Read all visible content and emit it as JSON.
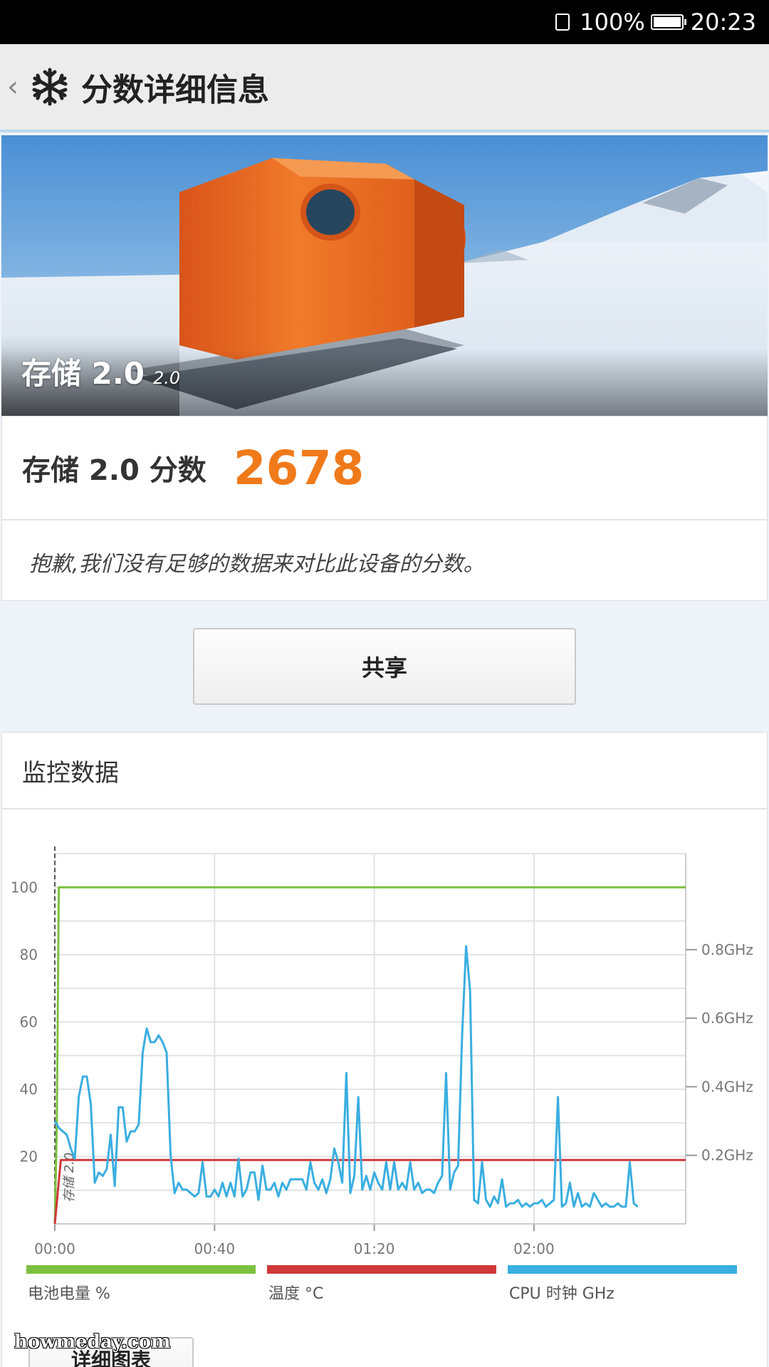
{
  "status_bar": {
    "battery": "100%",
    "time": "20:23"
  },
  "app_bar": {
    "back_icon": "chevron-left-icon",
    "logo_icon": "snowflake-icon",
    "title": "分数详细信息"
  },
  "hero": {
    "name": "存储 2.0",
    "version": "2.0"
  },
  "score": {
    "label": "存储 2.0 分数",
    "value": "2678",
    "value_color": "#f07a1a",
    "note": "抱歉,我们没有足够的数据来对比此设备的分数。"
  },
  "share_button": "共享",
  "monitor": {
    "title": "监控数据",
    "legend": [
      {
        "label": "电池电量 %",
        "color": "#7cc13f"
      },
      {
        "label": "温度 °C",
        "color": "#d0383a"
      },
      {
        "label": "CPU 时钟 GHz",
        "color": "#3aaee0"
      }
    ],
    "marker_label": "存储 2.0"
  },
  "chart_data": {
    "type": "line",
    "x_ticks": [
      "00:00",
      "00:40",
      "01:20",
      "02:00"
    ],
    "x_range_minutes": [
      0,
      158
    ],
    "y_left_ticks": [
      "100",
      "80",
      "60",
      "40",
      "20"
    ],
    "y_left_range": [
      0,
      110
    ],
    "y_right_ticks": [
      "0.8GHz",
      "0.6GHz",
      "0.4GHz",
      "0.2GHz"
    ],
    "y_right_range_ghz": [
      0,
      1.08
    ],
    "grid": true,
    "legend_position": "bottom",
    "series": [
      {
        "name": "电池电量 %",
        "axis": "left",
        "points": [
          [
            0,
            0
          ],
          [
            0.5,
            30
          ],
          [
            1,
            100
          ],
          [
            158,
            100
          ]
        ]
      },
      {
        "name": "温度 °C",
        "axis": "left",
        "points": [
          [
            0,
            0
          ],
          [
            1.5,
            19
          ],
          [
            158,
            19
          ]
        ]
      },
      {
        "name": "CPU 时钟 GHz",
        "axis": "right",
        "points": [
          [
            0,
            0.3
          ],
          [
            1,
            0.28
          ],
          [
            2,
            0.27
          ],
          [
            3,
            0.26
          ],
          [
            4,
            0.22
          ],
          [
            5,
            0.19
          ],
          [
            6,
            0.37
          ],
          [
            7,
            0.43
          ],
          [
            8,
            0.43
          ],
          [
            9,
            0.35
          ],
          [
            10,
            0.12
          ],
          [
            11,
            0.15
          ],
          [
            12,
            0.14
          ],
          [
            13,
            0.16
          ],
          [
            14,
            0.26
          ],
          [
            15,
            0.11
          ],
          [
            16,
            0.34
          ],
          [
            17,
            0.34
          ],
          [
            18,
            0.24
          ],
          [
            19,
            0.27
          ],
          [
            20,
            0.27
          ],
          [
            21,
            0.29
          ],
          [
            22,
            0.5
          ],
          [
            23,
            0.57
          ],
          [
            24,
            0.53
          ],
          [
            25,
            0.53
          ],
          [
            26,
            0.55
          ],
          [
            27,
            0.53
          ],
          [
            28,
            0.5
          ],
          [
            29,
            0.2
          ],
          [
            30,
            0.09
          ],
          [
            31,
            0.12
          ],
          [
            32,
            0.1
          ],
          [
            33,
            0.1
          ],
          [
            34,
            0.09
          ],
          [
            35,
            0.08
          ],
          [
            36,
            0.09
          ],
          [
            37,
            0.18
          ],
          [
            38,
            0.08
          ],
          [
            39,
            0.08
          ],
          [
            40,
            0.1
          ],
          [
            41,
            0.08
          ],
          [
            42,
            0.12
          ],
          [
            43,
            0.08
          ],
          [
            44,
            0.12
          ],
          [
            45,
            0.08
          ],
          [
            46,
            0.19
          ],
          [
            47,
            0.08
          ],
          [
            48,
            0.1
          ],
          [
            49,
            0.15
          ],
          [
            50,
            0.15
          ],
          [
            51,
            0.07
          ],
          [
            52,
            0.17
          ],
          [
            53,
            0.1
          ],
          [
            54,
            0.1
          ],
          [
            55,
            0.12
          ],
          [
            56,
            0.08
          ],
          [
            57,
            0.12
          ],
          [
            58,
            0.1
          ],
          [
            59,
            0.13
          ],
          [
            60,
            0.13
          ],
          [
            61,
            0.13
          ],
          [
            62,
            0.13
          ],
          [
            63,
            0.1
          ],
          [
            64,
            0.18
          ],
          [
            65,
            0.12
          ],
          [
            66,
            0.1
          ],
          [
            67,
            0.13
          ],
          [
            68,
            0.09
          ],
          [
            69,
            0.13
          ],
          [
            70,
            0.22
          ],
          [
            71,
            0.18
          ],
          [
            72,
            0.12
          ],
          [
            73,
            0.44
          ],
          [
            74,
            0.09
          ],
          [
            75,
            0.14
          ],
          [
            76,
            0.37
          ],
          [
            77,
            0.1
          ],
          [
            78,
            0.14
          ],
          [
            79,
            0.1
          ],
          [
            80,
            0.15
          ],
          [
            81,
            0.12
          ],
          [
            82,
            0.1
          ],
          [
            83,
            0.18
          ],
          [
            84,
            0.1
          ],
          [
            85,
            0.18
          ],
          [
            86,
            0.1
          ],
          [
            87,
            0.12
          ],
          [
            88,
            0.1
          ],
          [
            89,
            0.18
          ],
          [
            90,
            0.1
          ],
          [
            91,
            0.12
          ],
          [
            92,
            0.09
          ],
          [
            93,
            0.1
          ],
          [
            94,
            0.1
          ],
          [
            95,
            0.09
          ],
          [
            96,
            0.12
          ],
          [
            97,
            0.14
          ],
          [
            98,
            0.44
          ],
          [
            99,
            0.1
          ],
          [
            100,
            0.15
          ],
          [
            101,
            0.17
          ],
          [
            102,
            0.55
          ],
          [
            103,
            0.81
          ],
          [
            104,
            0.68
          ],
          [
            105,
            0.07
          ],
          [
            106,
            0.06
          ],
          [
            107,
            0.18
          ],
          [
            108,
            0.07
          ],
          [
            109,
            0.05
          ],
          [
            110,
            0.08
          ],
          [
            111,
            0.06
          ],
          [
            112,
            0.13
          ],
          [
            113,
            0.05
          ],
          [
            114,
            0.06
          ],
          [
            115,
            0.06
          ],
          [
            116,
            0.07
          ],
          [
            117,
            0.05
          ],
          [
            118,
            0.06
          ],
          [
            119,
            0.05
          ],
          [
            120,
            0.06
          ],
          [
            121,
            0.06
          ],
          [
            122,
            0.07
          ],
          [
            123,
            0.05
          ],
          [
            124,
            0.06
          ],
          [
            125,
            0.07
          ],
          [
            126,
            0.37
          ],
          [
            127,
            0.05
          ],
          [
            128,
            0.06
          ],
          [
            129,
            0.12
          ],
          [
            130,
            0.05
          ],
          [
            131,
            0.09
          ],
          [
            132,
            0.05
          ],
          [
            133,
            0.06
          ],
          [
            134,
            0.05
          ],
          [
            135,
            0.09
          ],
          [
            136,
            0.07
          ],
          [
            137,
            0.05
          ],
          [
            138,
            0.06
          ],
          [
            139,
            0.05
          ],
          [
            140,
            0.05
          ],
          [
            141,
            0.06
          ],
          [
            142,
            0.05
          ],
          [
            143,
            0.05
          ],
          [
            144,
            0.18
          ],
          [
            145,
            0.06
          ],
          [
            146,
            0.05
          ]
        ]
      }
    ]
  },
  "detail_button": "详细图表",
  "watermark": "howmeday.com"
}
